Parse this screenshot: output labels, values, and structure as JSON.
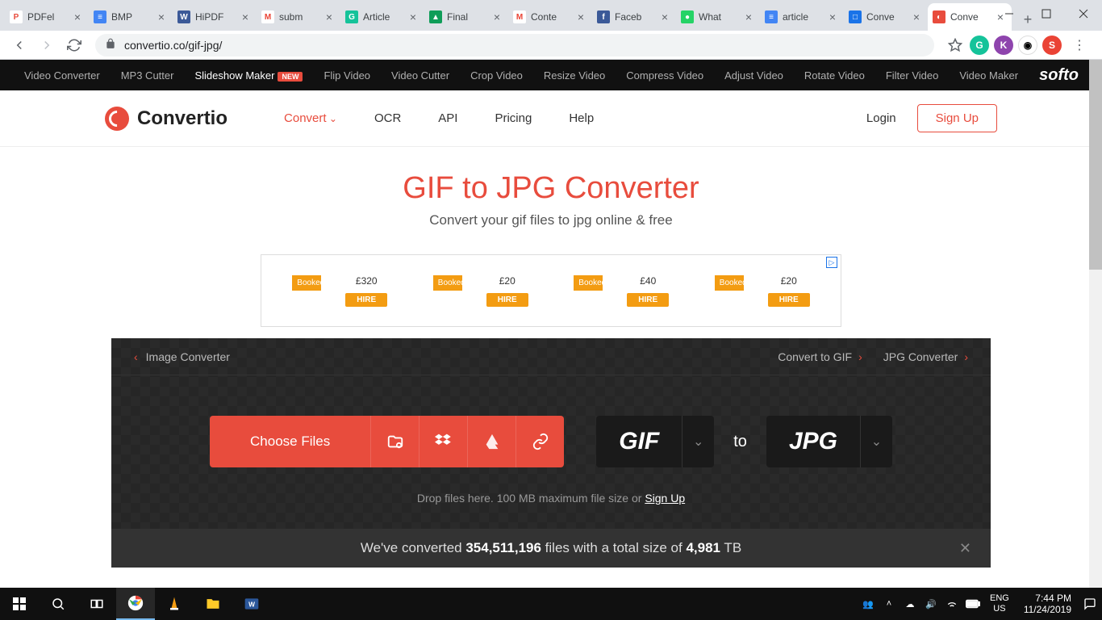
{
  "tabs": [
    {
      "label": "PDFel",
      "icon_bg": "#fff",
      "icon_fg": "#e84c3d",
      "icon_txt": "P"
    },
    {
      "label": "BMP",
      "icon_bg": "#4285f4",
      "icon_fg": "#fff",
      "icon_txt": "≡"
    },
    {
      "label": "HiPDF",
      "icon_bg": "#3b5998",
      "icon_fg": "#fff",
      "icon_txt": "W"
    },
    {
      "label": "subm",
      "icon_bg": "#fff",
      "icon_fg": "#ea4335",
      "icon_txt": "M"
    },
    {
      "label": "Article",
      "icon_bg": "#15c39a",
      "icon_fg": "#fff",
      "icon_txt": "G"
    },
    {
      "label": "Final",
      "icon_bg": "#0f9d58",
      "icon_fg": "#fff",
      "icon_txt": "▲"
    },
    {
      "label": "Conte",
      "icon_bg": "#fff",
      "icon_fg": "#ea4335",
      "icon_txt": "M"
    },
    {
      "label": "Faceb",
      "icon_bg": "#3b5998",
      "icon_fg": "#fff",
      "icon_txt": "f"
    },
    {
      "label": "What",
      "icon_bg": "#25d366",
      "icon_fg": "#fff",
      "icon_txt": "●"
    },
    {
      "label": "article",
      "icon_bg": "#4285f4",
      "icon_fg": "#fff",
      "icon_txt": "≡"
    },
    {
      "label": "Conve",
      "icon_bg": "#1a73e8",
      "icon_fg": "#fff",
      "icon_txt": "□"
    },
    {
      "label": "Conve",
      "icon_bg": "#e84c3d",
      "icon_fg": "#fff",
      "icon_txt": "◐",
      "active": true
    }
  ],
  "url": "convertio.co/gif-jpg/",
  "softo": {
    "items": [
      "Video Converter",
      "MP3 Cutter",
      "Slideshow Maker",
      "Flip Video",
      "Video Cutter",
      "Crop Video",
      "Resize Video",
      "Compress Video",
      "Adjust Video",
      "Rotate Video",
      "Filter Video",
      "Video Maker"
    ],
    "new_badge": "NEW",
    "logo": "softo"
  },
  "brand": "Convertio",
  "nav": {
    "convert": "Convert",
    "ocr": "OCR",
    "api": "API",
    "pricing": "Pricing",
    "help": "Help"
  },
  "auth": {
    "login": "Login",
    "signup": "Sign Up"
  },
  "hero": {
    "title": "GIF to JPG Converter",
    "subtitle": "Convert your gif files to jpg online & free"
  },
  "ad": {
    "units": [
      {
        "box": "Booked...",
        "price": "£320",
        "hire": "HIRE"
      },
      {
        "box": "Booked...",
        "price": "£20",
        "hire": "HIRE"
      },
      {
        "box": "Booked...",
        "price": "£40",
        "hire": "HIRE"
      },
      {
        "box": "Booked...",
        "price": "£20",
        "hire": "HIRE"
      }
    ]
  },
  "crumbs": {
    "back": "Image Converter",
    "r1": "Convert to GIF",
    "r2": "JPG Converter"
  },
  "choose": "Choose Files",
  "fmt": {
    "from": "GIF",
    "to_word": "to",
    "to": "JPG"
  },
  "hint": {
    "pre": "Drop files here. 100 MB maximum file size or ",
    "link": "Sign Up"
  },
  "stats": {
    "t1": "We've converted ",
    "n1": "354,511,196",
    "t2": " files with a total size of ",
    "n2": "4,981",
    "t3": " TB"
  },
  "tray": {
    "lang1": "ENG",
    "lang2": "US",
    "time": "7:44 PM",
    "date": "11/24/2019"
  }
}
